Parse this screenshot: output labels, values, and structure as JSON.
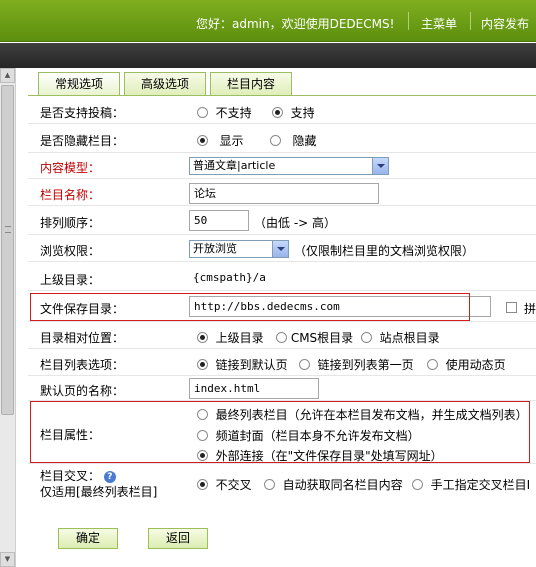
{
  "header": {
    "greeting": "您好：admin，欢迎使用DEDECMS!",
    "menu_main": "主菜单",
    "menu_publish": "内容发布"
  },
  "tabs": [
    {
      "label": "常规选项"
    },
    {
      "label": "高级选项"
    },
    {
      "label": "栏目内容"
    }
  ],
  "form": {
    "support_submit": {
      "label": "是否支持投稿：",
      "options": [
        "不支持",
        "支持"
      ],
      "selected": "支持"
    },
    "hide_column": {
      "label": "是否隐藏栏目：",
      "options": [
        "显示",
        "隐藏"
      ],
      "selected": "显示"
    },
    "content_model": {
      "label": "内容模型：",
      "value": "普通文章|article"
    },
    "column_name": {
      "label": "栏目名称：",
      "value": "论坛"
    },
    "sort_order": {
      "label": "排列顺序：",
      "value": "50",
      "hint": "（由低 -> 高）"
    },
    "browse_permission": {
      "label": "浏览权限：",
      "value": "开放浏览",
      "hint": "（仅限制栏目里的文档浏览权限）"
    },
    "parent_dir": {
      "label": "上级目录：",
      "value": "{cmspath}/a"
    },
    "save_dir": {
      "label": "文件保存目录：",
      "value": "http://bbs.dedecms.com",
      "cut_label": "拼"
    },
    "dir_relative": {
      "label": "目录相对位置：",
      "options": [
        "上级目录",
        "CMS根目录",
        "站点根目录"
      ],
      "selected": "上级目录"
    },
    "list_option": {
      "label": "栏目列表选项：",
      "options": [
        "链接到默认页",
        "链接到列表第一页",
        "使用动态页"
      ],
      "selected": "链接到默认页"
    },
    "default_page": {
      "label": "默认页的名称：",
      "value": "index.html"
    },
    "column_attr": {
      "label": "栏目属性：",
      "options": [
        "最终列表栏目（允许在本栏目发布文档，并生成文档列表）",
        "频道封面（栏目本身不允许发布文档）",
        "外部连接（在\"文件保存目录\"处填写网址）"
      ],
      "selected": "外部连接（在\"文件保存目录\"处填写网址）"
    },
    "cross_column": {
      "label_line1": "栏目交叉：",
      "help_glyph": "?",
      "label_line2": "仅适用[最终列表栏目]",
      "options": [
        "不交叉",
        "自动获取同名栏目内容",
        "手工指定交叉栏目I"
      ],
      "selected": "不交叉"
    }
  },
  "buttons": {
    "confirm": "确定",
    "back": "返回"
  },
  "scrollbar": {
    "up_glyph": "▲",
    "down_glyph": "▼"
  }
}
